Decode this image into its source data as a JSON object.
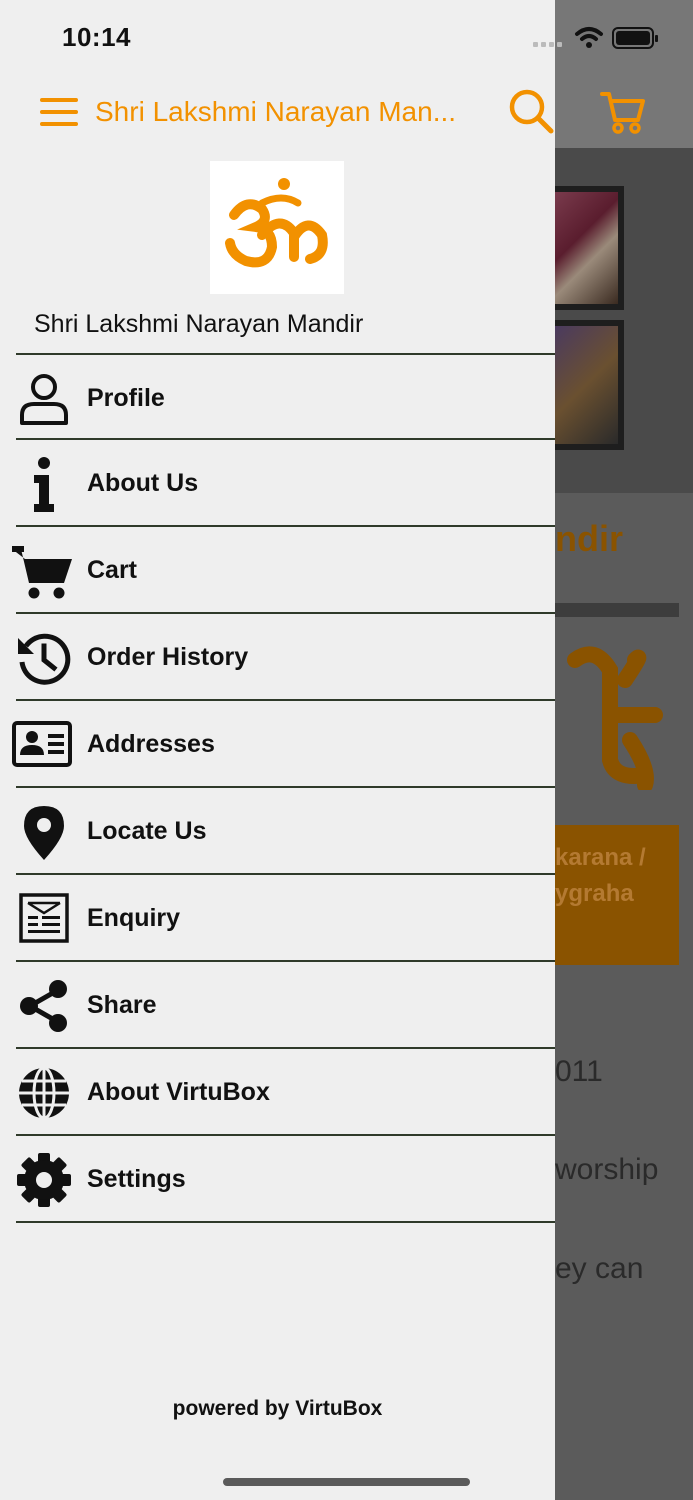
{
  "status_bar": {
    "time": "10:14",
    "icons": [
      "signal-icon",
      "wifi-icon",
      "battery-icon"
    ]
  },
  "header": {
    "title": "Shri Lakshmi Narayan Man...",
    "icons": [
      "menu-icon",
      "search-icon",
      "cart-icon"
    ],
    "accent_color": "#f29100"
  },
  "drawer": {
    "logo_icon": "om-icon",
    "temple_name": "Shri Lakshmi Narayan Mandir",
    "menu": [
      {
        "id": "profile",
        "label": "Profile",
        "icon": "user-icon"
      },
      {
        "id": "about-us",
        "label": "About Us",
        "icon": "info-icon"
      },
      {
        "id": "cart",
        "label": "Cart",
        "icon": "cart-icon"
      },
      {
        "id": "order-history",
        "label": "Order History",
        "icon": "history-icon"
      },
      {
        "id": "addresses",
        "label": "Addresses",
        "icon": "address-card-icon"
      },
      {
        "id": "locate-us",
        "label": "Locate Us",
        "icon": "map-pin-icon"
      },
      {
        "id": "enquiry",
        "label": "Enquiry",
        "icon": "enquiry-form-icon"
      },
      {
        "id": "share",
        "label": "Share",
        "icon": "share-icon"
      },
      {
        "id": "about-virtubox",
        "label": "About VirtuBox",
        "icon": "globe-icon"
      },
      {
        "id": "settings",
        "label": "Settings",
        "icon": "gear-icon"
      }
    ],
    "footer": "powered by VirtuBox"
  },
  "background_page": {
    "title_fragment": "ndir",
    "orange_box_lines": [
      "karana /",
      "ygraha"
    ],
    "text_lines": [
      "011",
      "worship",
      "ey can"
    ],
    "overlay_color": "#5b5b5b"
  }
}
